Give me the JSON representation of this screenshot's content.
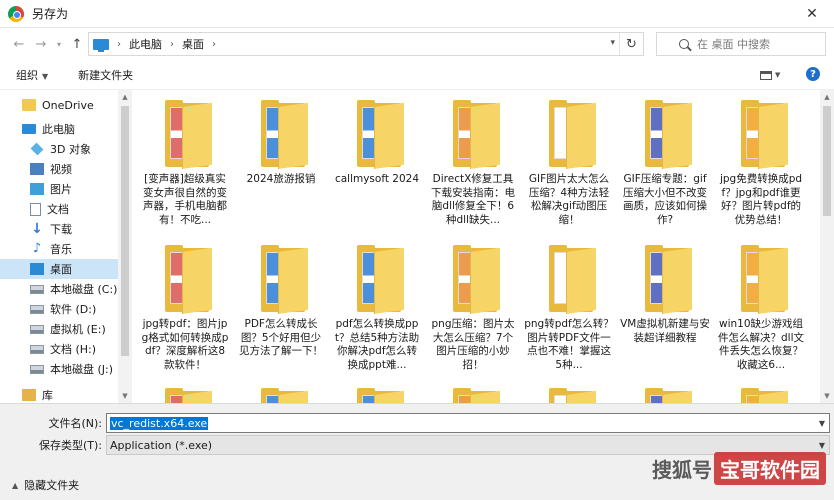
{
  "window": {
    "title": "另存为"
  },
  "address": {
    "crumbs": [
      "此电脑",
      "桌面"
    ],
    "search_placeholder": "在 桌面 中搜索"
  },
  "toolbar": {
    "organize": "组织",
    "new_folder": "新建文件夹"
  },
  "sidebar": {
    "items": [
      {
        "label": "OneDrive",
        "icon": "folder-icon"
      },
      {
        "label": "此电脑",
        "icon": "computer-icon"
      },
      {
        "label": "3D 对象",
        "icon": "3d-objects-icon"
      },
      {
        "label": "视频",
        "icon": "video-icon"
      },
      {
        "label": "图片",
        "icon": "pictures-icon"
      },
      {
        "label": "文档",
        "icon": "documents-icon"
      },
      {
        "label": "下载",
        "icon": "download-icon"
      },
      {
        "label": "音乐",
        "icon": "music-icon"
      },
      {
        "label": "桌面",
        "icon": "desktop-icon",
        "selected": true
      },
      {
        "label": "本地磁盘 (C:)",
        "icon": "drive-icon"
      },
      {
        "label": "软件 (D:)",
        "icon": "drive-icon"
      },
      {
        "label": "虚拟机 (E:)",
        "icon": "drive-icon"
      },
      {
        "label": "文档 (H:)",
        "icon": "drive-icon"
      },
      {
        "label": "本地磁盘 (J:)",
        "icon": "drive-icon"
      },
      {
        "label": "库",
        "icon": "library-icon"
      }
    ]
  },
  "files": {
    "row1": [
      {
        "label": "[变声器]超级真实变女声很自然的变声器，手机电脑都有！不吃..."
      },
      {
        "label": "2024旅游报销"
      },
      {
        "label": "callmysoft 2024"
      },
      {
        "label": "DirectX修复工具下载安装指南：电脑dll修复全下！6种dll缺失..."
      },
      {
        "label": "GIF图片太大怎么压缩？4种方法轻松解决gif动图压缩！"
      },
      {
        "label": "GIF压缩专题：gif压缩大小但不改变画质，应该如何操作?"
      },
      {
        "label": "jpg免费转换成pdf？jpg和pdf谁更好？图片转pdf的优势总结！"
      }
    ],
    "row2": [
      {
        "label": "jpg转pdf：图片jpg格式如何转换成pdf？深度解析这8款软件！"
      },
      {
        "label": "PDF怎么转成长图？5个好用但少见方法了解一下！"
      },
      {
        "label": "pdf怎么转换成ppt？总结5种方法助你解决pdf怎么转换成ppt难..."
      },
      {
        "label": "png压缩：图片太大怎么压缩？7个图片压缩的小妙招！"
      },
      {
        "label": "png转pdf怎么转？图片转PDF文件一点也不难！掌握这5种..."
      },
      {
        "label": "VM虚拟机新建与安装超详细教程"
      },
      {
        "label": "win10缺少游戏组件怎么解决？dll文件丢失怎么恢复？收藏这6..."
      }
    ]
  },
  "fields": {
    "filename_label": "文件名(N):",
    "filename_value": "vc_redist.x64.exe",
    "filetype_label": "保存类型(T):",
    "filetype_value": "Application (*.exe)"
  },
  "footer": {
    "hide_folders": "隐藏文件夹"
  },
  "watermark": {
    "left": "搜狐号",
    "right": "宝哥软件园"
  }
}
